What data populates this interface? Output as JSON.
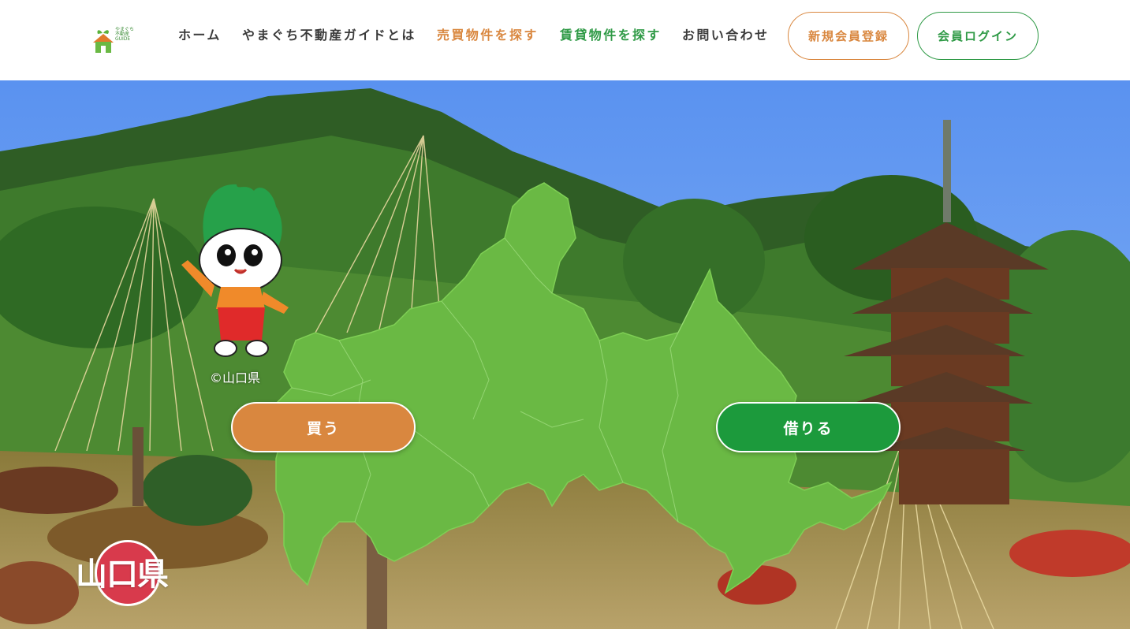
{
  "header": {
    "logo": {
      "line1": "やまぐち",
      "line2": "不動産",
      "line3": "GUIDE",
      "icon": "house-leaf-icon"
    },
    "nav": [
      {
        "label": "ホーム",
        "color": "#3a3a3a"
      },
      {
        "label": "やまぐち不動産ガイドとは",
        "color": "#3a3a3a"
      },
      {
        "label": "売買物件を探す",
        "color": "#d9873f"
      },
      {
        "label": "賃貸物件を探す",
        "color": "#2f9a46"
      },
      {
        "label": "お問い合わせ",
        "color": "#3a3a3a"
      }
    ],
    "register_label": "新規会員登録",
    "login_label": "会員ログイン"
  },
  "hero": {
    "buy_label": "買う",
    "rent_label": "借りる",
    "copyright": "©山口県",
    "prefecture_label": "山口県",
    "mascot_icon": "mascot-character-icon",
    "map_icon": "yamaguchi-map-icon"
  },
  "colors": {
    "accent_orange": "#d9873f",
    "accent_green": "#1c9a3c",
    "map_green": "#6ab944",
    "badge_red": "#d83a4c"
  }
}
